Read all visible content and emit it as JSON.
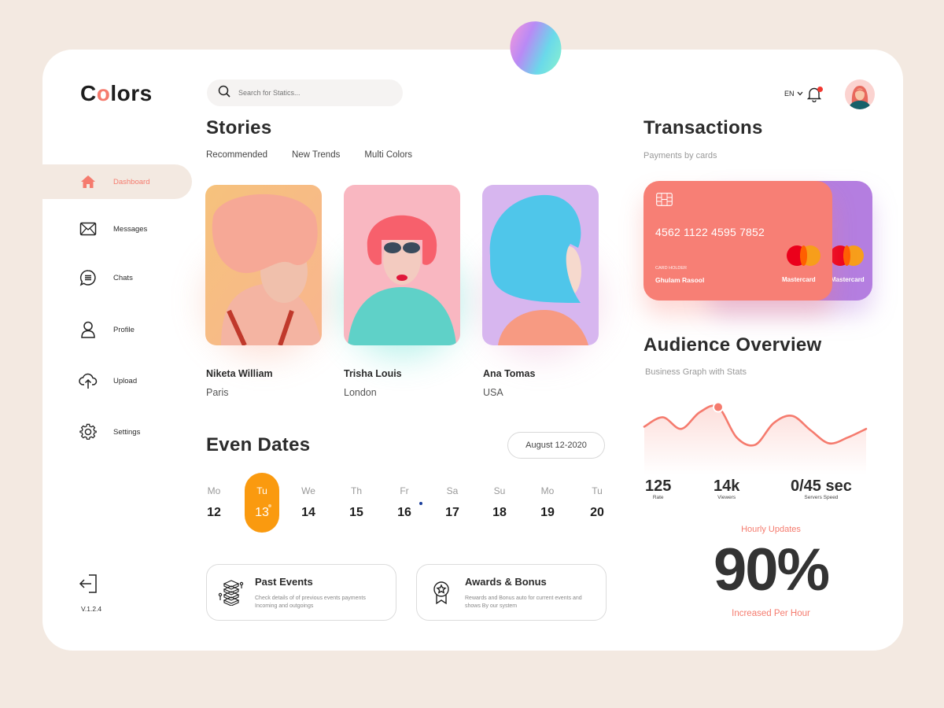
{
  "app": {
    "logo_prefix": "C",
    "logo_o": "o",
    "logo_suffix": "lors",
    "version": "V.1.2.4"
  },
  "sidebar": {
    "items": [
      {
        "label": "Dashboard",
        "icon": "home-icon",
        "active": true
      },
      {
        "label": "Messages",
        "icon": "mail-icon"
      },
      {
        "label": "Chats",
        "icon": "chat-icon"
      },
      {
        "label": "Profile",
        "icon": "user-icon"
      },
      {
        "label": "Upload",
        "icon": "cloud-upload-icon"
      },
      {
        "label": "Settings",
        "icon": "gear-icon"
      }
    ],
    "logout_icon": "logout-icon"
  },
  "header": {
    "search_placeholder": "Search for Statics...",
    "language": "EN",
    "notifications": true
  },
  "stories": {
    "title": "Stories",
    "tabs": [
      "Recommended",
      "New Trends",
      "Multi Colors"
    ],
    "items": [
      {
        "name": "Niketa William",
        "city": "Paris"
      },
      {
        "name": "Trisha Louis",
        "city": "London"
      },
      {
        "name": "Ana Tomas",
        "city": "USA"
      }
    ]
  },
  "dates": {
    "title": "Even Dates",
    "selected_range": "August 12-2020",
    "days": [
      {
        "dn": "Mo",
        "dd": "12"
      },
      {
        "dn": "Tu",
        "dd": "13",
        "selected": true
      },
      {
        "dn": "We",
        "dd": "14"
      },
      {
        "dn": "Th",
        "dd": "15"
      },
      {
        "dn": "Fr",
        "dd": "16",
        "event": true
      },
      {
        "dn": "Sa",
        "dd": "17"
      },
      {
        "dn": "Su",
        "dd": "18"
      },
      {
        "dn": "Mo",
        "dd": "19"
      },
      {
        "dn": "Tu",
        "dd": "20"
      }
    ]
  },
  "cards": [
    {
      "title": "Past Events",
      "desc": "Check details of of previous events payments Incoming and outgoings",
      "icon": "stack-icon"
    },
    {
      "title": "Awards & Bonus",
      "desc": "Rewards and Bonus auto for current events and shows By our system",
      "icon": "award-icon"
    }
  ],
  "transactions": {
    "title": "Transactions",
    "subtitle": "Payments by cards",
    "card": {
      "number": "4562 1122 4595 7852",
      "holder_label": "CARD HOLDER",
      "holder": "Ghulam Rasool",
      "brand": "Mastercard",
      "color": "#f77f75"
    },
    "back_card": {
      "brand": "Mastercard",
      "color": "#b47ee0"
    }
  },
  "audience": {
    "title": "Audience Overview",
    "subtitle": "Business Graph with Stats",
    "stats": [
      {
        "value": "125",
        "label": "Rate"
      },
      {
        "value": "14k",
        "label": "Viewers"
      },
      {
        "value": "0/45 sec",
        "label": "Servers Speed"
      }
    ],
    "hourly_label": "Hourly Updates",
    "hourly_value": "90%",
    "hourly_caption": "Increased Per Hour"
  },
  "chart_data": {
    "type": "line",
    "title": "",
    "xlabel": "",
    "ylabel": "",
    "x": [
      0,
      1,
      2,
      3,
      4,
      5,
      6,
      7,
      8,
      9,
      10,
      11,
      12
    ],
    "values": [
      55,
      68,
      52,
      75,
      82,
      40,
      30,
      60,
      70,
      50,
      32,
      40,
      52
    ],
    "highlight_index": 4,
    "ylim": [
      0,
      100
    ],
    "grid": false,
    "color": "#f57b6e"
  },
  "colors": {
    "accent": "#f57b6e",
    "selected_day": "#fa9a0f",
    "event_dot": "#1a3f9c"
  }
}
